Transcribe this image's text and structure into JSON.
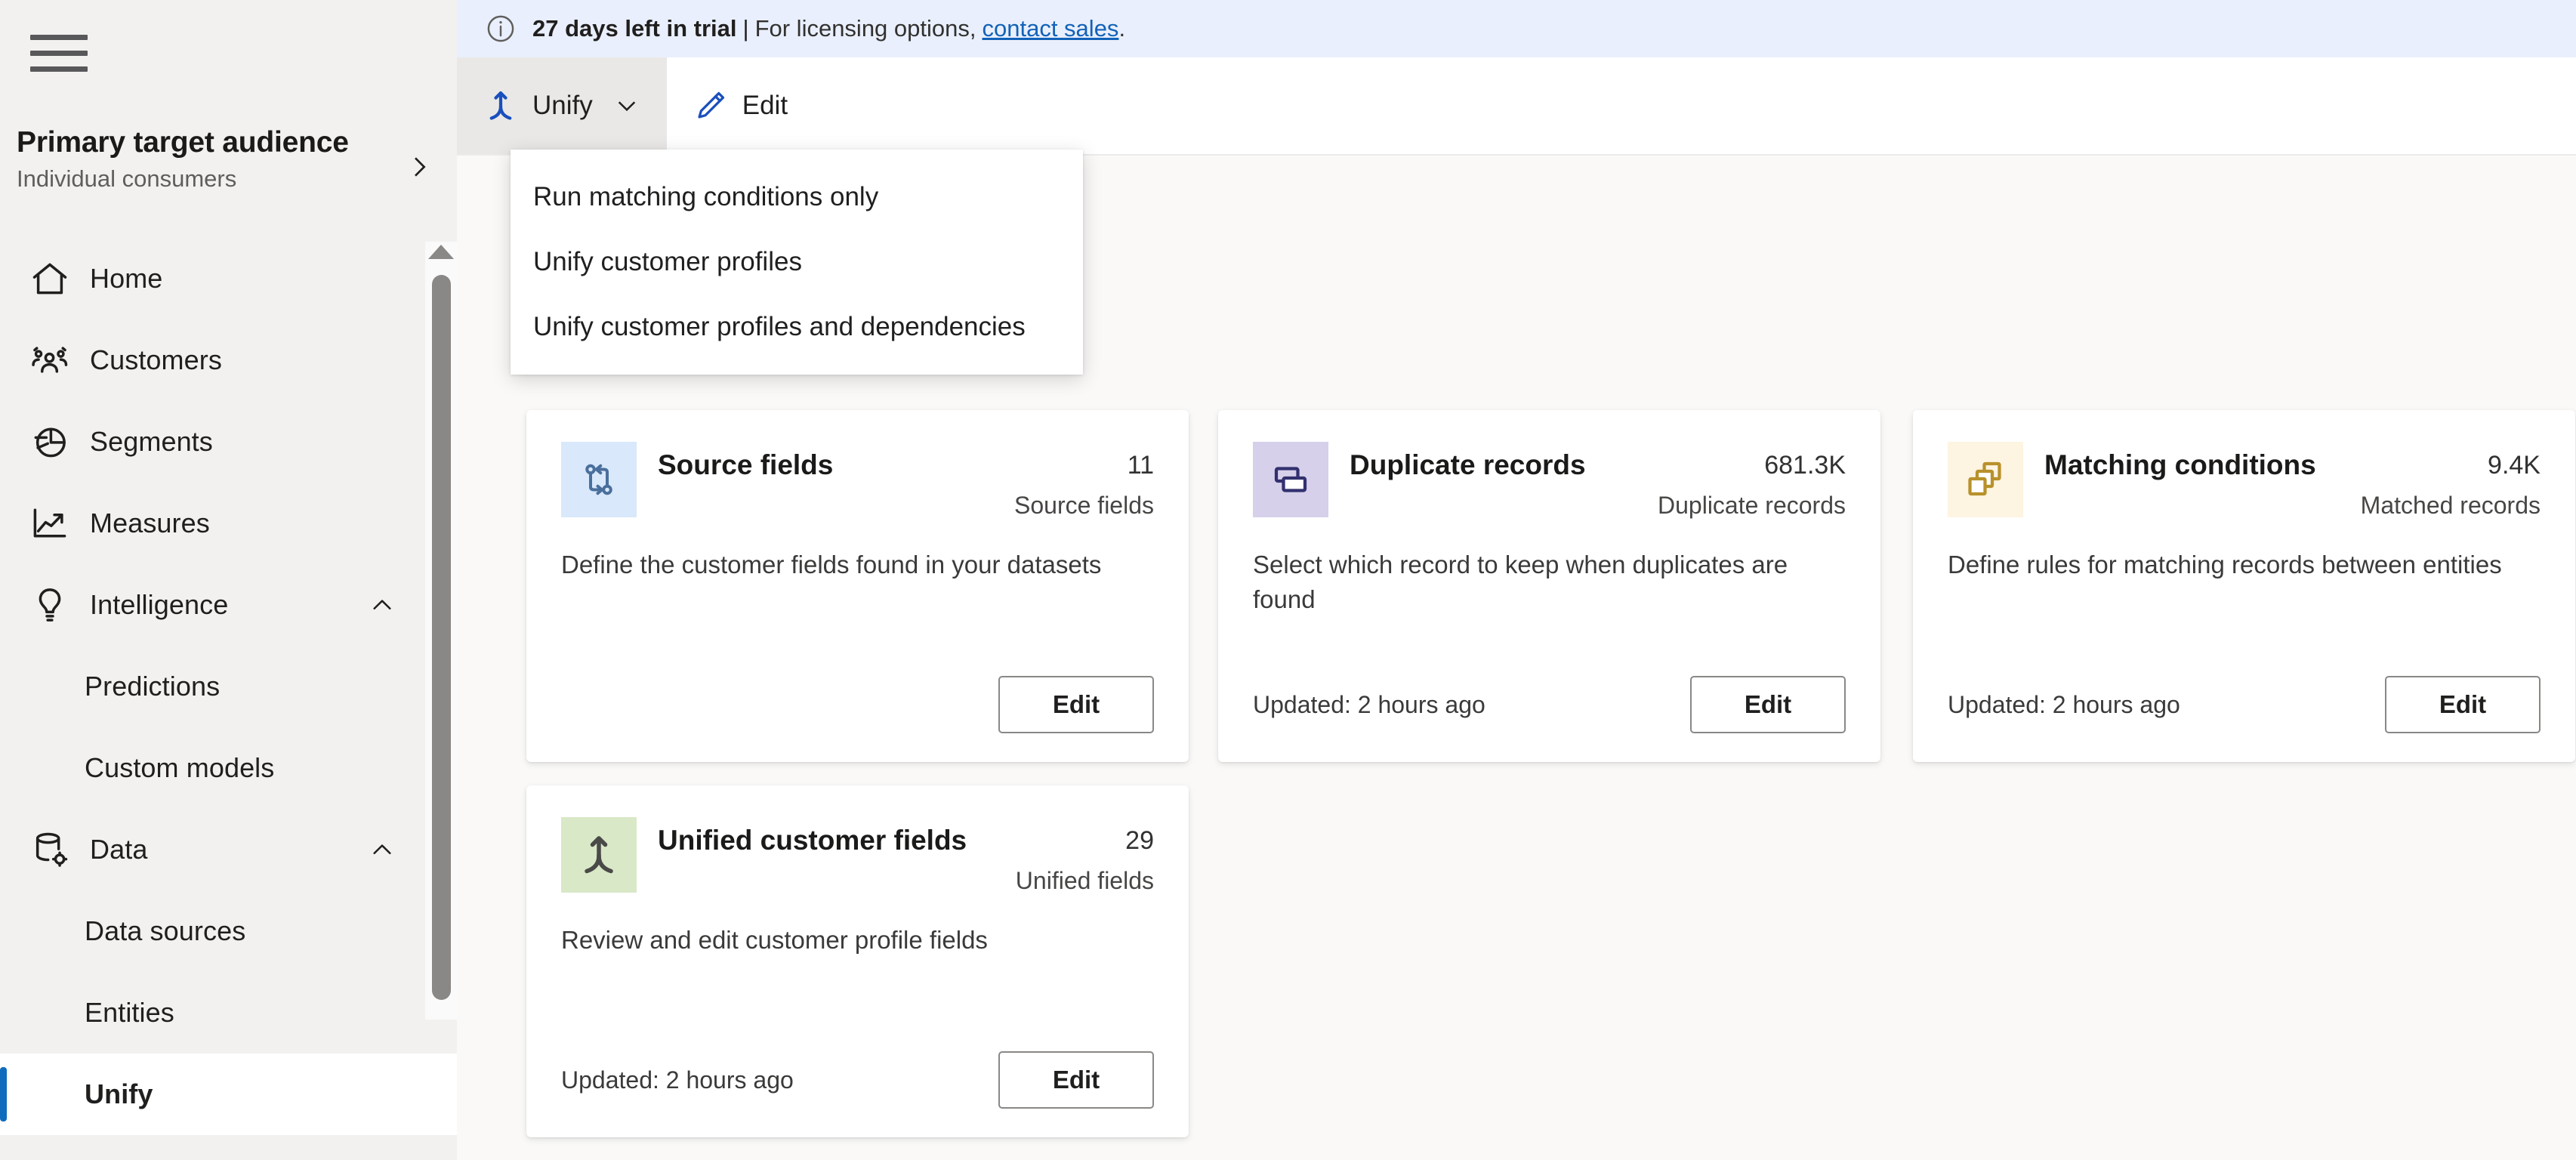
{
  "sidebar": {
    "hamburger_icon": "hamburger-menu-icon",
    "audience": {
      "title": "Primary target audience",
      "subtitle": "Individual consumers",
      "chevron_icon": "chevron-right-icon"
    },
    "items": [
      {
        "label": "Home",
        "icon": "home-icon",
        "level": "top",
        "expand": "",
        "active": false
      },
      {
        "label": "Customers",
        "icon": "people-icon",
        "level": "top",
        "expand": "",
        "active": false
      },
      {
        "label": "Segments",
        "icon": "pie-chart-icon",
        "level": "top",
        "expand": "",
        "active": false
      },
      {
        "label": "Measures",
        "icon": "line-chart-icon",
        "level": "top",
        "expand": "",
        "active": false
      },
      {
        "label": "Intelligence",
        "icon": "lightbulb-icon",
        "level": "top",
        "expand": "chevron-up-icon",
        "active": false
      },
      {
        "label": "Predictions",
        "icon": "",
        "level": "sub",
        "expand": "",
        "active": false
      },
      {
        "label": "Custom models",
        "icon": "",
        "level": "sub",
        "expand": "",
        "active": false
      },
      {
        "label": "Data",
        "icon": "database-gear-icon",
        "level": "top",
        "expand": "chevron-up-icon",
        "active": false
      },
      {
        "label": "Data sources",
        "icon": "",
        "level": "sub",
        "expand": "",
        "active": false
      },
      {
        "label": "Entities",
        "icon": "",
        "level": "sub",
        "expand": "",
        "active": false
      },
      {
        "label": "Unify",
        "icon": "",
        "level": "sub",
        "expand": "",
        "active": true
      }
    ],
    "scrollbar": {
      "up_arrow_icon": "scroll-up-arrow-icon"
    }
  },
  "banner": {
    "info_icon": "info-circle-icon",
    "days_text": "27 days left in trial",
    "separator": "|",
    "message": "For licensing options,",
    "link_text": "contact sales",
    "period": "."
  },
  "toolbar": {
    "unify": {
      "label": "Unify",
      "icon": "unify-merge-icon",
      "chevron_icon": "chevron-down-icon"
    },
    "edit": {
      "label": "Edit",
      "icon": "pencil-edit-icon"
    }
  },
  "dropdown": {
    "items": [
      {
        "label": "Run matching conditions only"
      },
      {
        "label": "Unify customer profiles"
      },
      {
        "label": "Unify customer profiles and dependencies"
      }
    ]
  },
  "cards": [
    {
      "title": "Source fields",
      "icon": "branch-fields-icon",
      "tile_bg": "#d9e8fb",
      "icon_color": "#4a6f9c",
      "metric_value": "11",
      "metric_label": "Source fields",
      "description": "Define the customer fields found in your datasets",
      "updated": "",
      "button_label": "Edit"
    },
    {
      "title": "Duplicate records",
      "icon": "duplicate-windows-icon",
      "tile_bg": "#d6d0ea",
      "icon_color": "#32306f",
      "metric_value": "681.3K",
      "metric_label": "Duplicate records",
      "description": "Select which record to keep when duplicates are found",
      "updated": "Updated: 2 hours ago",
      "button_label": "Edit"
    },
    {
      "title": "Matching conditions",
      "icon": "overlapping-squares-icon",
      "tile_bg": "#fdf4e1",
      "icon_color": "#b8912b",
      "metric_value": "9.4K",
      "metric_label": "Matched records",
      "description": "Define rules for matching records between entities",
      "updated": "Updated: 2 hours ago",
      "button_label": "Edit"
    },
    {
      "title": "Unified customer fields",
      "icon": "unify-merge-icon",
      "tile_bg": "#d9e8c7",
      "icon_color": "#4a4a48",
      "metric_value": "29",
      "metric_label": "Unified fields",
      "description": "Review and edit customer profile fields",
      "updated": "Updated: 2 hours ago",
      "button_label": "Edit"
    }
  ],
  "colors": {
    "accent": "#0f6cbd",
    "banner_bg": "#e9effc",
    "sidebar_bg": "#f2f1f0",
    "canvas_bg": "#faf9f8",
    "link": "#1262b8"
  }
}
